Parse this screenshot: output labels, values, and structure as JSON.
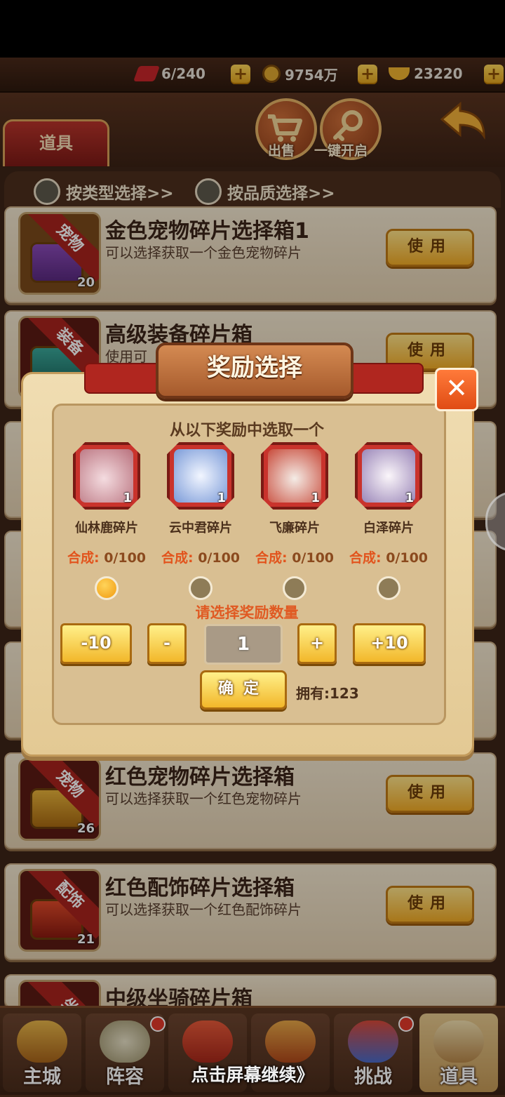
{
  "resources": [
    {
      "icon": "stamina-icon",
      "value": "6/240"
    },
    {
      "icon": "coin-icon",
      "value": "9754万"
    },
    {
      "icon": "gold-ingot-icon",
      "value": "23220"
    }
  ],
  "plus_label": "+",
  "header": {
    "tab_label": "道具",
    "sell_label": "出售",
    "open_all_label": "一键开启"
  },
  "filters": {
    "by_type": "按类型选择>>",
    "by_quality": "按品质选择>>"
  },
  "items": [
    {
      "tag": "宠物",
      "count": "20",
      "title": "金色宠物碎片选择箱1",
      "desc": "可以选择获取一个金色宠物碎片",
      "button": "使用"
    },
    {
      "tag": "装备",
      "count": "",
      "title": "高级装备碎片箱",
      "desc": "使用可",
      "button": "使用"
    },
    {
      "tag": "宠物",
      "count": "26",
      "title": "红色宠物碎片选择箱",
      "desc": "可以选择获取一个红色宠物碎片",
      "button": "使用"
    },
    {
      "tag": "配饰",
      "count": "21",
      "title": "红色配饰碎片选择箱",
      "desc": "可以选择获取一个红色配饰碎片",
      "button": "使用"
    },
    {
      "tag": "坐",
      "count": "",
      "title": "中级坐骑碎片箱",
      "desc": "",
      "button": ""
    }
  ],
  "dialog": {
    "title": "奖励选择",
    "prompt": "从以下奖励中选取一个",
    "rewards": [
      {
        "name": "仙林鹿碎片",
        "count": "1",
        "synth_label": "合成:",
        "synth_value": "0/100",
        "selected": true
      },
      {
        "name": "云中君碎片",
        "count": "1",
        "synth_label": "合成:",
        "synth_value": "0/100",
        "selected": false
      },
      {
        "name": "飞廉碎片",
        "count": "1",
        "synth_label": "合成:",
        "synth_value": "0/100",
        "selected": false
      },
      {
        "name": "白泽碎片",
        "count": "1",
        "synth_label": "合成:",
        "synth_value": "0/100",
        "selected": false
      }
    ],
    "quantity_prompt": "请选择奖励数量",
    "minus10": "-10",
    "minus": "-",
    "quantity": "1",
    "plus": "+",
    "plus10": "+10",
    "confirm": "确定",
    "owned": "拥有:123",
    "close": "✕"
  },
  "bottom_nav": [
    {
      "label": "主城",
      "badge": false,
      "active": false
    },
    {
      "label": "阵容",
      "badge": true,
      "active": false
    },
    {
      "label": "",
      "badge": false,
      "active": false
    },
    {
      "label": "",
      "badge": false,
      "active": false
    },
    {
      "label": "挑战",
      "badge": true,
      "active": false
    },
    {
      "label": "道具",
      "badge": false,
      "active": true
    }
  ],
  "continue_hint": "点击屏幕继续》",
  "colors": {
    "accent_yellow": "#f2b72a",
    "tab_red": "#b8342b",
    "synth_orange": "#e2541d",
    "panel": "#d9bf92"
  }
}
